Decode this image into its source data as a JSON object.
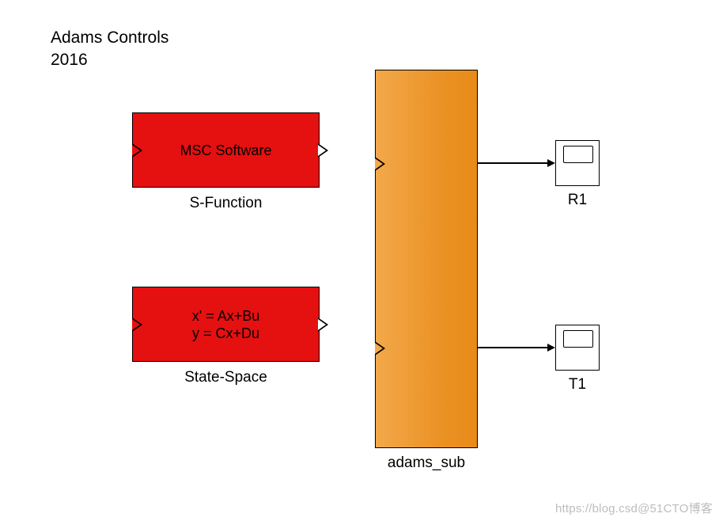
{
  "header": {
    "line1": "Adams Controls",
    "line2": "2016"
  },
  "blocks": {
    "sfunction": {
      "text": "MSC Software",
      "caption": "S-Function",
      "color": "#e51010"
    },
    "statespace": {
      "line1": "x' = Ax+Bu",
      "line2": "y = Cx+Du",
      "caption": "State-Space",
      "color": "#e51010"
    },
    "adams_sub": {
      "caption": "adams_sub",
      "color": "#ee9a2e"
    }
  },
  "scopes": {
    "r1": {
      "label": "R1"
    },
    "t1": {
      "label": "T1"
    }
  },
  "watermark": "https://blog.csd@51CTO博客"
}
